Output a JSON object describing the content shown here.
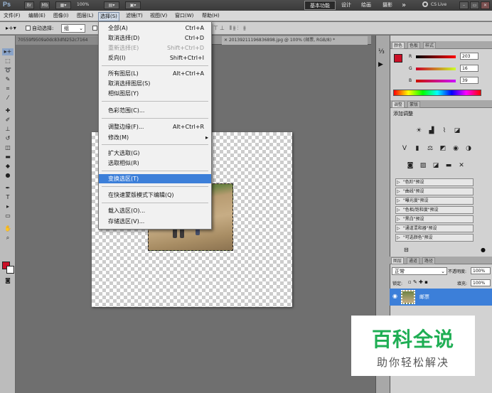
{
  "appbar": {
    "logo": "Ps",
    "bridge_label": "Br",
    "minibridge_label": "Mb",
    "zoom": "100%",
    "workspaces": [
      "基本功能",
      "设计",
      "绘画",
      "摄影"
    ],
    "more": "»",
    "cslive": "CS Live"
  },
  "menubar": {
    "items": [
      "文件(F)",
      "编辑(E)",
      "图像(I)",
      "图层(L)",
      "选择(S)",
      "滤镜(T)",
      "视图(V)",
      "窗口(W)",
      "帮助(H)"
    ]
  },
  "options": {
    "auto_select_label": "自动选择:",
    "auto_select_value": "组"
  },
  "tabs": {
    "doc1": "70559f9509a0dc83dfd252c7164",
    "doc2": "20139211196836898.jpg @ 100% (邮票, RGB/8) *"
  },
  "dropdown": {
    "items": [
      {
        "label": "全部(A)",
        "shortcut": "Ctrl+A"
      },
      {
        "label": "取消选择(D)",
        "shortcut": "Ctrl+D"
      },
      {
        "label": "重新选择(E)",
        "shortcut": "Shift+Ctrl+D"
      },
      {
        "label": "反向(I)",
        "shortcut": "Shift+Ctrl+I"
      },
      {
        "label": "所有图层(L)",
        "shortcut": "Alt+Ctrl+A"
      },
      {
        "label": "取消选择图层(S)",
        "shortcut": ""
      },
      {
        "label": "相似图层(Y)",
        "shortcut": ""
      },
      {
        "label": "色彩范围(C)...",
        "shortcut": ""
      },
      {
        "label": "调整边缘(F)...",
        "shortcut": "Alt+Ctrl+R"
      },
      {
        "label": "修改(M)",
        "shortcut": "▸"
      },
      {
        "label": "扩大选取(G)",
        "shortcut": ""
      },
      {
        "label": "选取相似(R)",
        "shortcut": ""
      },
      {
        "label": "变换选区(T)",
        "shortcut": ""
      },
      {
        "label": "在快速蒙版模式下编辑(Q)",
        "shortcut": ""
      },
      {
        "label": "载入选区(O)...",
        "shortcut": ""
      },
      {
        "label": "存储选区(V)...",
        "shortcut": ""
      }
    ]
  },
  "color_panel": {
    "tabs": [
      "颜色",
      "色板",
      "样式"
    ],
    "channels": [
      {
        "label": "R",
        "value": "203"
      },
      {
        "label": "G",
        "value": "16"
      },
      {
        "label": "B",
        "value": "39"
      }
    ],
    "fg_color": "#cb1027"
  },
  "adjust_panel": {
    "tabs": [
      "调整",
      "蒙版"
    ],
    "title": "添加调整",
    "presets": [
      "\"色阶\"预设",
      "\"曲线\"预设",
      "\"曝光度\"预设",
      "\"色相/饱和度\"预设",
      "\"黑白\"预设",
      "\"通道混和器\"预设",
      "\"可选颜色\"预设"
    ]
  },
  "layers_panel": {
    "tabs": [
      "图层",
      "通道",
      "路径"
    ],
    "blend_mode": "正常",
    "opacity_label": "不透明度:",
    "opacity": "100%",
    "lock_label": "锁定:",
    "fill_label": "填充:",
    "fill": "100%",
    "layer_name": "邮票"
  },
  "watermark": {
    "title": "百科全说",
    "subtitle": "助你轻松解决"
  }
}
